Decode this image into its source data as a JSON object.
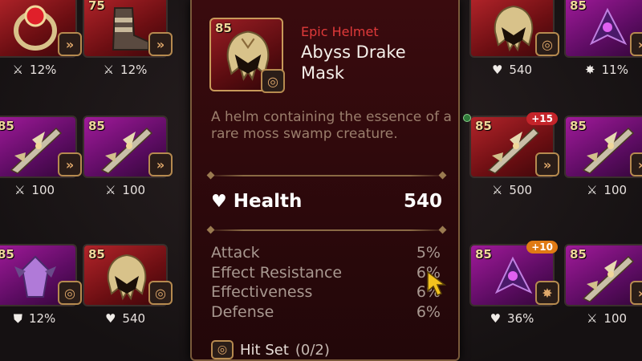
{
  "inventory": {
    "slots": [
      {
        "id": "r1c1",
        "color": "red",
        "level": "",
        "item": "ring",
        "set_icon": "speed-set-icon",
        "stat_icon": "crit-sword-icon",
        "stat": "12%"
      },
      {
        "id": "r1c2",
        "color": "red",
        "level": "75",
        "item": "boots",
        "set_icon": "speed-set-icon",
        "stat_icon": "crit-sword-icon",
        "stat": "12%"
      },
      {
        "id": "r1c6",
        "color": "red",
        "level": "",
        "item": "helmet",
        "set_icon": "hit-set-icon",
        "stat_icon": "heart-icon",
        "stat": "540"
      },
      {
        "id": "r1c7",
        "color": "purple",
        "level": "85",
        "item": "purple-gear",
        "set_icon": "speed-set-icon",
        "stat_icon": "effectiveness-icon",
        "stat": "11%"
      },
      {
        "id": "r2c1",
        "color": "purple",
        "level": "85",
        "item": "weapon",
        "set_icon": "speed-set-icon",
        "stat_icon": "attack-icon",
        "stat": "100"
      },
      {
        "id": "r2c2",
        "color": "purple",
        "level": "85",
        "item": "weapon",
        "set_icon": "speed-set-icon",
        "stat_icon": "attack-icon",
        "stat": "100"
      },
      {
        "id": "r2c6",
        "color": "red",
        "level": "85",
        "badge": "+15",
        "badge_color": "red",
        "item": "weapon",
        "set_icon": "speed-set-icon",
        "stat_icon": "attack-icon",
        "stat": "500"
      },
      {
        "id": "r2c7",
        "color": "purple",
        "level": "85",
        "item": "weapon",
        "set_icon": "speed-set-icon",
        "stat_icon": "attack-icon",
        "stat": "100"
      },
      {
        "id": "r3c1",
        "color": "purple",
        "level": "85",
        "item": "crystal",
        "set_icon": "hit-set-icon",
        "stat_icon": "shield-icon",
        "stat": "12%"
      },
      {
        "id": "r3c2",
        "color": "red",
        "level": "85",
        "item": "helmet",
        "set_icon": "hit-set-icon",
        "stat_icon": "heart-icon",
        "stat": "540"
      },
      {
        "id": "r3c6",
        "color": "purple",
        "level": "85",
        "badge": "+10",
        "badge_color": "orange",
        "item": "purple-gear",
        "set_icon": "destruction-set-icon",
        "stat_icon": "heart-icon",
        "stat": "36%"
      },
      {
        "id": "r3c7",
        "color": "purple",
        "level": "85",
        "item": "weapon",
        "set_icon": "speed-set-icon",
        "stat_icon": "attack-icon",
        "stat": "100"
      }
    ]
  },
  "tooltip": {
    "level": "85",
    "rarity": "Epic Helmet",
    "name": "Abyss Drake Mask",
    "description": "A helm containing the essence of a rare moss swamp creature.",
    "main_stat": {
      "icon": "heart-icon",
      "label": "Health",
      "value": "540"
    },
    "substats": [
      {
        "label": "Attack",
        "value": "5%"
      },
      {
        "label": "Effect Resistance",
        "value": "6%"
      },
      {
        "label": "Effectiveness",
        "value": "6%"
      },
      {
        "label": "Defense",
        "value": "6%"
      }
    ],
    "set": {
      "icon": "hit-set-icon",
      "label": "Hit Set",
      "count": "(0/2)"
    }
  },
  "colors": {
    "epic_red": "#e03a3a",
    "gold_border": "#b68a4f",
    "purple_card": "#a11a9a",
    "red_card": "#b3242a"
  }
}
